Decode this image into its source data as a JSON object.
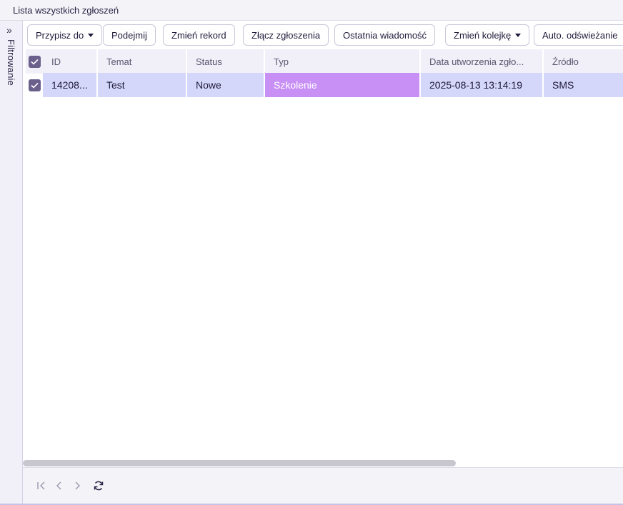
{
  "window": {
    "title": "Lista wszystkich zgłoszeń"
  },
  "sidebar": {
    "label": "Filtrowanie",
    "icon": "double-chevron-right-icon"
  },
  "toolbar": {
    "assign": "Przypisz do",
    "take": "Podejmij",
    "change_record": "Zmień rekord",
    "merge": "Złącz zgłoszenia",
    "last_message": "Ostatnia wiadomość",
    "change_queue": "Zmień kolejkę",
    "auto_refresh": "Auto. odświeżanie"
  },
  "table": {
    "columns": [
      "ID",
      "Temat",
      "Status",
      "Typ",
      "Data utworzenia zgło...",
      "Źródło"
    ],
    "rows": [
      {
        "selected": true,
        "id": "14208...",
        "topic": "Test",
        "status": "Nowe",
        "type": "Szkolenie",
        "created": "2025-08-13 13:14:19",
        "source": "SMS"
      }
    ]
  },
  "colors": {
    "selected_row": "#d4d6fa",
    "type_badge": "#c890f5",
    "checkbox": "#6b5f8c"
  }
}
